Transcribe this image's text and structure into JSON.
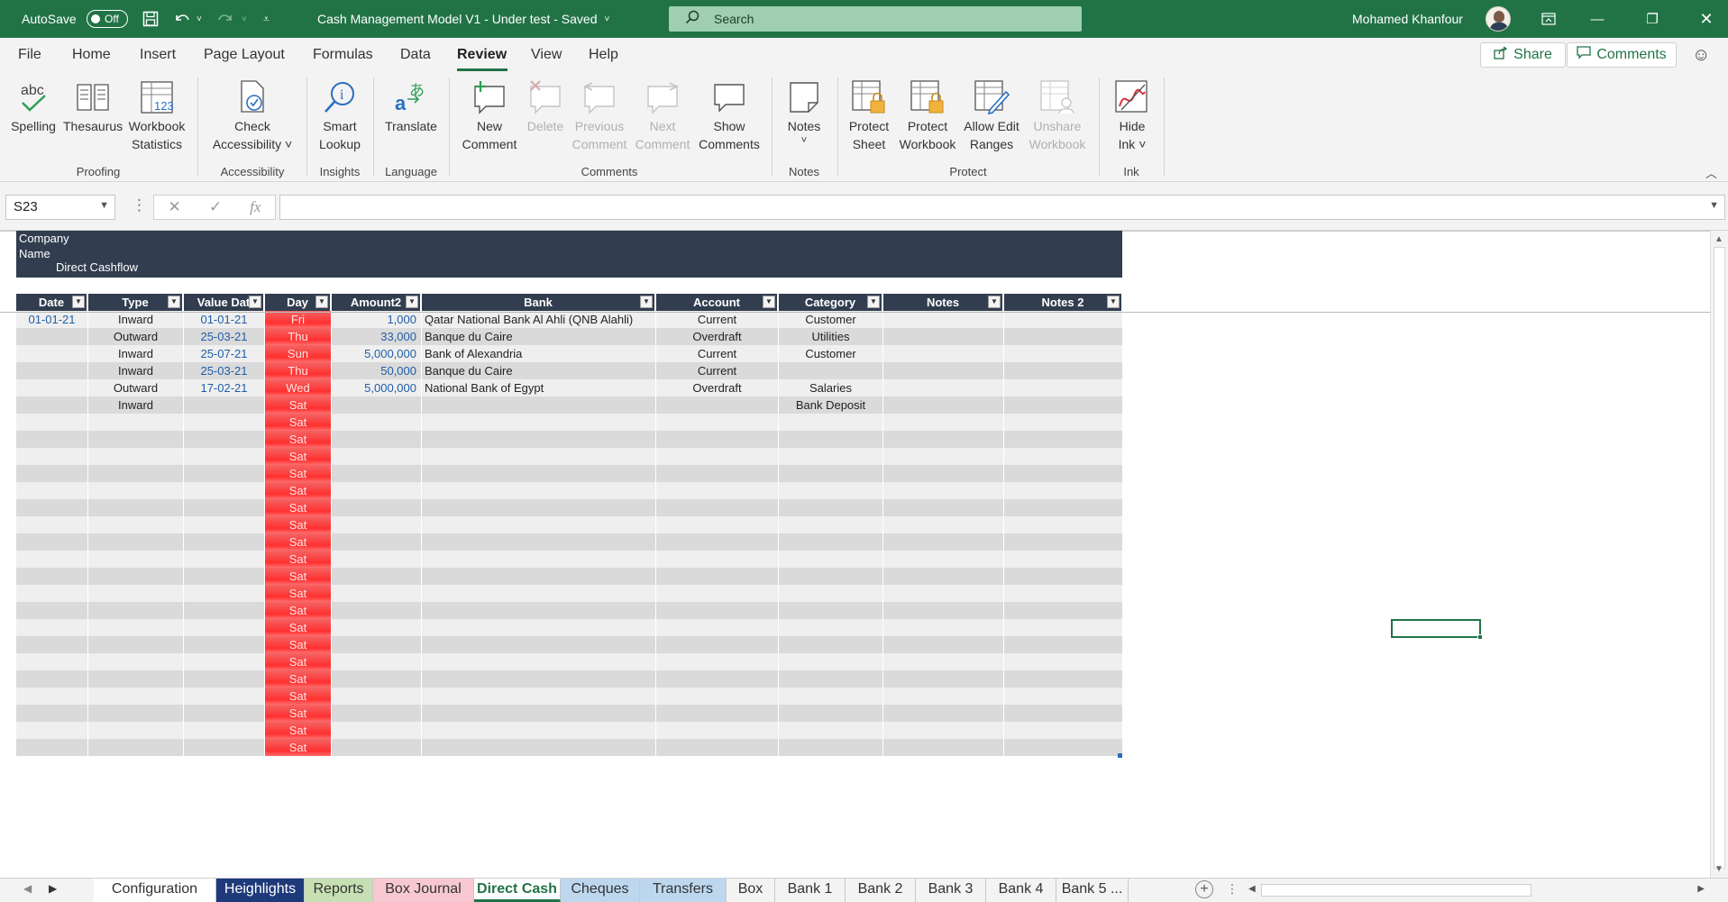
{
  "titlebar": {
    "autosave_label": "AutoSave",
    "autosave_state": "Off",
    "doc_title": "Cash Management Model V1 - Under test  -  Saved",
    "search_placeholder": "Search",
    "user_name": "Mohamed Khanfour"
  },
  "menu": {
    "tabs": [
      "File",
      "Home",
      "Insert",
      "Page Layout",
      "Formulas",
      "Data",
      "Review",
      "View",
      "Help"
    ],
    "active": "Review",
    "share_label": "Share",
    "comments_label": "Comments"
  },
  "ribbon": {
    "groups": {
      "proofing": "Proofing",
      "accessibility": "Accessibility",
      "insights": "Insights",
      "language": "Language",
      "comments": "Comments",
      "notes": "Notes",
      "protect": "Protect",
      "ink": "Ink"
    },
    "buttons": {
      "spelling": "Spelling",
      "thesaurus": "Thesaurus",
      "workbook_stats_1": "Workbook",
      "workbook_stats_2": "Statistics",
      "check_access_1": "Check",
      "check_access_2": "Accessibility ˅",
      "smart_lookup_1": "Smart",
      "smart_lookup_2": "Lookup",
      "translate": "Translate",
      "new_comment_1": "New",
      "new_comment_2": "Comment",
      "delete": "Delete",
      "previous_1": "Previous",
      "previous_2": "Comment",
      "next_1": "Next",
      "next_2": "Comment",
      "show_comments_1": "Show",
      "show_comments_2": "Comments",
      "notes": "Notes",
      "notes_caret": "˅",
      "protect_sheet_1": "Protect",
      "protect_sheet_2": "Sheet",
      "protect_wb_1": "Protect",
      "protect_wb_2": "Workbook",
      "allow_edit_1": "Allow Edit",
      "allow_edit_2": "Ranges",
      "unshare_1": "Unshare",
      "unshare_2": "Workbook",
      "hide_ink_1": "Hide",
      "hide_ink_2": "Ink ˅"
    }
  },
  "formula_bar": {
    "name_box": "S23",
    "fx_label": "fx",
    "formula": ""
  },
  "sheet": {
    "company_line1": "Company",
    "company_line2": "Name",
    "subtitle": "Direct Cashflow",
    "columns": [
      "Date",
      "Type",
      "Value Dat",
      "Day",
      "Amount2",
      "Bank",
      "Account",
      "Category",
      "Notes",
      "Notes 2"
    ],
    "rows": [
      {
        "date": "01-01-21",
        "type": "Inward",
        "value_date": "01-01-21",
        "day": "Fri",
        "amount": "1,000",
        "bank": "Qatar National Bank Al Ahli (QNB Alahli)",
        "account": "Current",
        "category": "Customer",
        "notes": "",
        "notes2": ""
      },
      {
        "date": "",
        "type": "Outward",
        "value_date": "25-03-21",
        "day": "Thu",
        "amount": "33,000",
        "bank": "Banque du Caire",
        "account": "Overdraft",
        "category": "Utilities",
        "notes": "",
        "notes2": ""
      },
      {
        "date": "",
        "type": "Inward",
        "value_date": "25-07-21",
        "day": "Sun",
        "amount": "5,000,000",
        "bank": "Bank of Alexandria",
        "account": "Current",
        "category": "Customer",
        "notes": "",
        "notes2": ""
      },
      {
        "date": "",
        "type": "Inward",
        "value_date": "25-03-21",
        "day": "Thu",
        "amount": "50,000",
        "bank": "Banque du Caire",
        "account": "Current",
        "category": "",
        "notes": "",
        "notes2": ""
      },
      {
        "date": "",
        "type": "Outward",
        "value_date": "17-02-21",
        "day": "Wed",
        "amount": "5,000,000",
        "bank": "National Bank of Egypt",
        "account": "Overdraft",
        "category": "Salaries",
        "notes": "",
        "notes2": ""
      },
      {
        "date": "",
        "type": "Inward",
        "value_date": "",
        "day": "Sat",
        "amount": "",
        "bank": "",
        "account": "",
        "category": "Bank Deposit",
        "notes": "",
        "notes2": ""
      },
      {
        "date": "",
        "type": "",
        "value_date": "",
        "day": "Sat",
        "amount": "",
        "bank": "",
        "account": "",
        "category": "",
        "notes": "",
        "notes2": ""
      },
      {
        "date": "",
        "type": "",
        "value_date": "",
        "day": "Sat",
        "amount": "",
        "bank": "",
        "account": "",
        "category": "",
        "notes": "",
        "notes2": ""
      },
      {
        "date": "",
        "type": "",
        "value_date": "",
        "day": "Sat",
        "amount": "",
        "bank": "",
        "account": "",
        "category": "",
        "notes": "",
        "notes2": ""
      },
      {
        "date": "",
        "type": "",
        "value_date": "",
        "day": "Sat",
        "amount": "",
        "bank": "",
        "account": "",
        "category": "",
        "notes": "",
        "notes2": ""
      },
      {
        "date": "",
        "type": "",
        "value_date": "",
        "day": "Sat",
        "amount": "",
        "bank": "",
        "account": "",
        "category": "",
        "notes": "",
        "notes2": ""
      },
      {
        "date": "",
        "type": "",
        "value_date": "",
        "day": "Sat",
        "amount": "",
        "bank": "",
        "account": "",
        "category": "",
        "notes": "",
        "notes2": ""
      },
      {
        "date": "",
        "type": "",
        "value_date": "",
        "day": "Sat",
        "amount": "",
        "bank": "",
        "account": "",
        "category": "",
        "notes": "",
        "notes2": ""
      },
      {
        "date": "",
        "type": "",
        "value_date": "",
        "day": "Sat",
        "amount": "",
        "bank": "",
        "account": "",
        "category": "",
        "notes": "",
        "notes2": ""
      },
      {
        "date": "",
        "type": "",
        "value_date": "",
        "day": "Sat",
        "amount": "",
        "bank": "",
        "account": "",
        "category": "",
        "notes": "",
        "notes2": ""
      },
      {
        "date": "",
        "type": "",
        "value_date": "",
        "day": "Sat",
        "amount": "",
        "bank": "",
        "account": "",
        "category": "",
        "notes": "",
        "notes2": ""
      },
      {
        "date": "",
        "type": "",
        "value_date": "",
        "day": "Sat",
        "amount": "",
        "bank": "",
        "account": "",
        "category": "",
        "notes": "",
        "notes2": ""
      },
      {
        "date": "",
        "type": "",
        "value_date": "",
        "day": "Sat",
        "amount": "",
        "bank": "",
        "account": "",
        "category": "",
        "notes": "",
        "notes2": ""
      },
      {
        "date": "",
        "type": "",
        "value_date": "",
        "day": "Sat",
        "amount": "",
        "bank": "",
        "account": "",
        "category": "",
        "notes": "",
        "notes2": ""
      },
      {
        "date": "",
        "type": "",
        "value_date": "",
        "day": "Sat",
        "amount": "",
        "bank": "",
        "account": "",
        "category": "",
        "notes": "",
        "notes2": ""
      },
      {
        "date": "",
        "type": "",
        "value_date": "",
        "day": "Sat",
        "amount": "",
        "bank": "",
        "account": "",
        "category": "",
        "notes": "",
        "notes2": ""
      },
      {
        "date": "",
        "type": "",
        "value_date": "",
        "day": "Sat",
        "amount": "",
        "bank": "",
        "account": "",
        "category": "",
        "notes": "",
        "notes2": ""
      },
      {
        "date": "",
        "type": "",
        "value_date": "",
        "day": "Sat",
        "amount": "",
        "bank": "",
        "account": "",
        "category": "",
        "notes": "",
        "notes2": ""
      },
      {
        "date": "",
        "type": "",
        "value_date": "",
        "day": "Sat",
        "amount": "",
        "bank": "",
        "account": "",
        "category": "",
        "notes": "",
        "notes2": ""
      },
      {
        "date": "",
        "type": "",
        "value_date": "",
        "day": "Sat",
        "amount": "",
        "bank": "",
        "account": "",
        "category": "",
        "notes": "",
        "notes2": ""
      },
      {
        "date": "",
        "type": "",
        "value_date": "",
        "day": "Sat",
        "amount": "",
        "bank": "",
        "account": "",
        "category": "",
        "notes": "",
        "notes2": ""
      }
    ]
  },
  "sheet_tabs": [
    {
      "label": "Configuration",
      "color": "#ffffff",
      "text": "#333333"
    },
    {
      "label": "Heighlights",
      "color": "#1f3a7a",
      "text": "#ffffff"
    },
    {
      "label": "Reports",
      "color": "#c6e0b4",
      "text": "#333333"
    },
    {
      "label": "Box Journal",
      "color": "#f8c8d0",
      "text": "#333333"
    },
    {
      "label": "Direct Cash",
      "color": "#ffffff",
      "text": "#217346",
      "active": true
    },
    {
      "label": "Cheques",
      "color": "#bdd7ee",
      "text": "#333333"
    },
    {
      "label": "Transfers",
      "color": "#bdd7ee",
      "text": "#333333"
    },
    {
      "label": "Box",
      "color": "#f3f3f3",
      "text": "#333333"
    },
    {
      "label": "Bank 1",
      "color": "#f3f3f3",
      "text": "#333333"
    },
    {
      "label": "Bank 2",
      "color": "#f3f3f3",
      "text": "#333333"
    },
    {
      "label": "Bank 3",
      "color": "#f3f3f3",
      "text": "#333333"
    },
    {
      "label": "Bank 4",
      "color": "#f3f3f3",
      "text": "#333333"
    },
    {
      "label": "Bank 5 ...",
      "color": "#f3f3f3",
      "text": "#333333"
    }
  ],
  "colors": {
    "brand": "#217346",
    "header": "#323e4f",
    "row_even": "#efefef",
    "row_odd": "#dadada",
    "day_red": "#ff3b3b",
    "link_blue": "#1f5ea8"
  }
}
